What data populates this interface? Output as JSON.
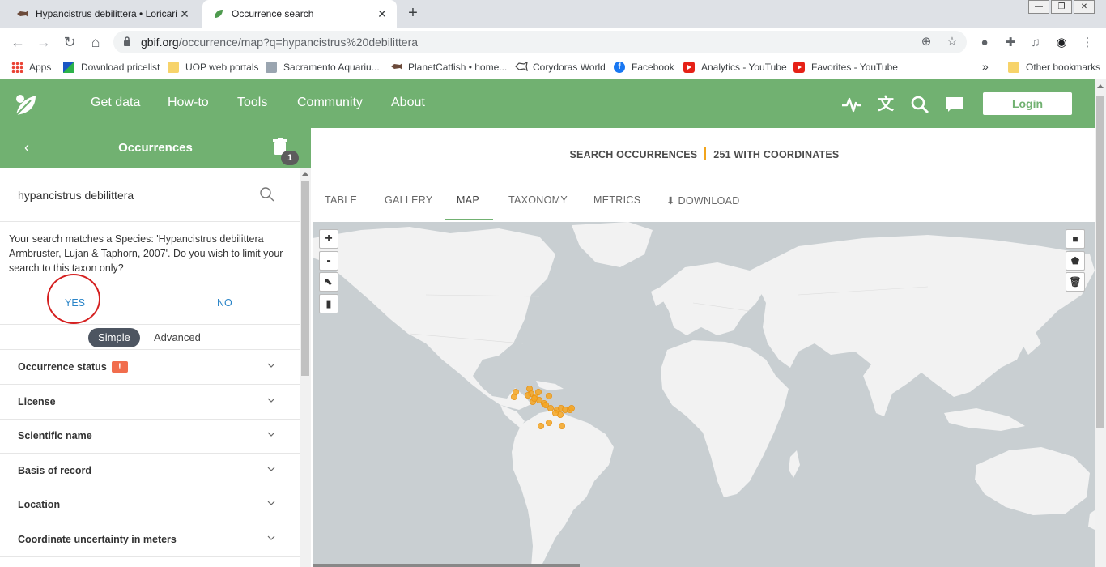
{
  "browser": {
    "tabs": [
      {
        "title": "Hypancistrus debilittera • Loricariida",
        "close": "✕"
      },
      {
        "title": "Occurrence search",
        "close": "✕"
      }
    ],
    "new_tab": "+",
    "url_host": "gbif.org",
    "url_path": "/occurrence/map?q=hypancistrus%20debilittera",
    "bookmarks": [
      {
        "label": "Apps",
        "icon": "apps-grid-icon"
      },
      {
        "label": "Download pricelist",
        "icon": "flag-icon"
      },
      {
        "label": "UOP web portals",
        "icon": "folder-icon"
      },
      {
        "label": "Sacramento Aquariu...",
        "icon": "aquarium-icon"
      },
      {
        "label": "PlanetCatfish • home...",
        "icon": "catfish-icon"
      },
      {
        "label": "Corydoras World",
        "icon": "fish-icon"
      },
      {
        "label": "Facebook",
        "icon": "facebook-icon"
      },
      {
        "label": "Analytics - YouTube",
        "icon": "youtube-icon"
      },
      {
        "label": "Favorites - YouTube",
        "icon": "youtube-icon"
      }
    ],
    "more_bookmarks": "»",
    "other_bookmarks": "Other bookmarks"
  },
  "gbif": {
    "nav": [
      "Get data",
      "How-to",
      "Tools",
      "Community",
      "About"
    ],
    "login": "Login",
    "icons": [
      "activity-icon",
      "translate-icon",
      "search-icon",
      "feedback-icon"
    ]
  },
  "panel": {
    "title": "Occurrences",
    "back": "‹",
    "badge": "1",
    "search_value": "hypancistrus debilittera",
    "match_text": "Your search matches a Species: 'Hypancistrus debilittera Armbruster, Lujan & Taphorn, 2007'. Do you wish to limit your search to this taxon only?",
    "yes": "YES",
    "no": "NO",
    "mode_simple": "Simple",
    "mode_advanced": "Advanced",
    "filters": [
      {
        "label": "Occurrence status",
        "warning": "!"
      },
      {
        "label": "License"
      },
      {
        "label": "Scientific name"
      },
      {
        "label": "Basis of record"
      },
      {
        "label": "Location"
      },
      {
        "label": "Coordinate uncertainty in meters"
      }
    ]
  },
  "results": {
    "heading_left": "SEARCH OCCURRENCES",
    "heading_right": "251 WITH COORDINATES",
    "tabs": [
      "TABLE",
      "GALLERY",
      "MAP",
      "TAXONOMY",
      "METRICS",
      "DOWNLOAD"
    ],
    "active_tab": "MAP",
    "map_controls": {
      "zoom_in": "+",
      "zoom_out": "-"
    }
  },
  "colors": {
    "gbif_green": "#71b171",
    "occurrence_dot": "#f5a623",
    "link_blue": "#2b85c8",
    "highlight_circle": "#d52020"
  }
}
